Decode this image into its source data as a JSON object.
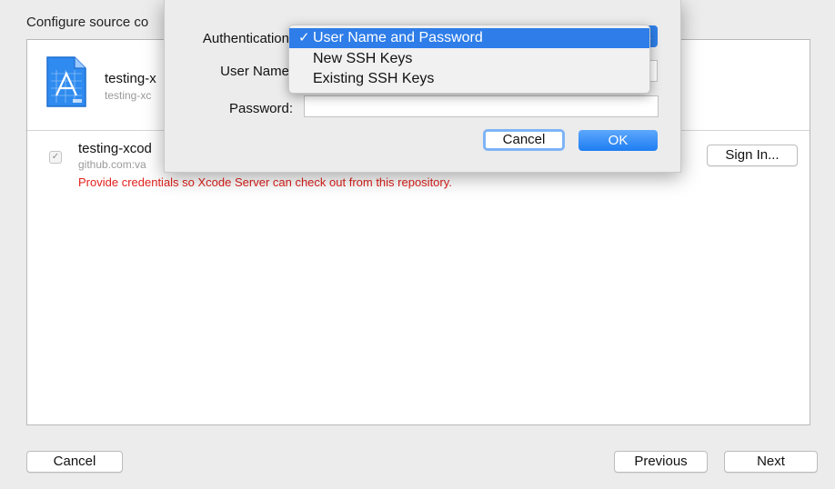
{
  "page": {
    "title": "Configure source co"
  },
  "project": {
    "name": "testing-x",
    "subtitle": "testing-xc"
  },
  "repository": {
    "checkbox": "✓",
    "name": "testing-xcod",
    "host": "github.com:va",
    "warning": "Provide credentials so Xcode Server can check out from this repository.",
    "signin_label": "Sign In..."
  },
  "footer": {
    "cancel_label": "Cancel",
    "previous_label": "Previous",
    "next_label": "Next"
  },
  "sheet": {
    "authentication_label": "Authentication",
    "username_label": "User Name",
    "password_label": "Password:",
    "cancel_label": "Cancel",
    "ok_label": "OK"
  },
  "auth_menu": {
    "selected_check": "✓",
    "options": [
      "User Name and Password",
      "New SSH Keys",
      "Existing SSH Keys"
    ]
  },
  "colors": {
    "accent": "#2e7de9",
    "warning": "#e0201b"
  }
}
